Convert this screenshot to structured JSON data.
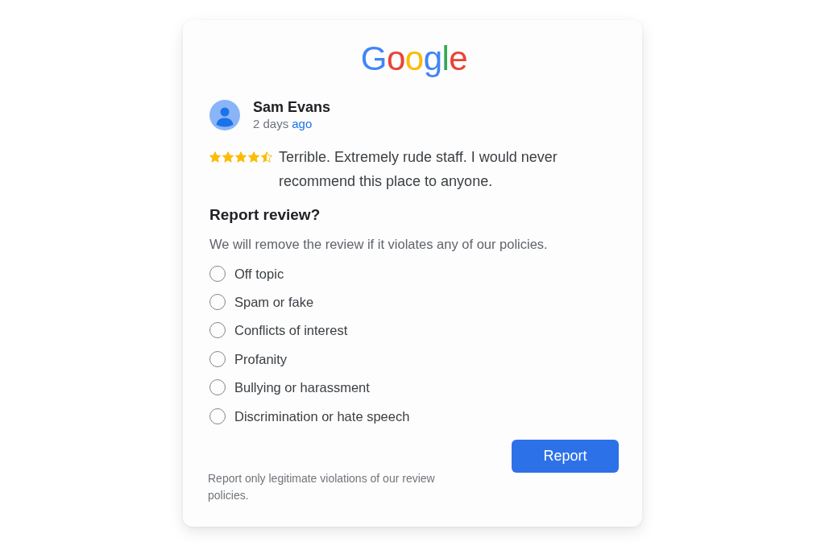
{
  "logo": "Google",
  "review": {
    "author": "Sam Evans",
    "posted": "2 days",
    "posted_link": "ago",
    "stars": 4.5,
    "text": "Terrible. Extremely rude staff. I would never recommend this place to anyone."
  },
  "report": {
    "title": "Report review?",
    "description": "We will remove the review if it violates any of our policies.",
    "options": [
      {
        "label": "Off topic",
        "selected": false
      },
      {
        "label": "Spam or fake",
        "selected": false
      },
      {
        "label": "Conflicts of interest",
        "selected": false
      },
      {
        "label": "Profanity",
        "selected": false
      },
      {
        "label": "Bullying or harassment",
        "selected": false
      },
      {
        "label": "Discrimination or hate speech",
        "selected": false
      }
    ],
    "button": "Report",
    "note": "Report only legitimate violations of our review policies."
  }
}
